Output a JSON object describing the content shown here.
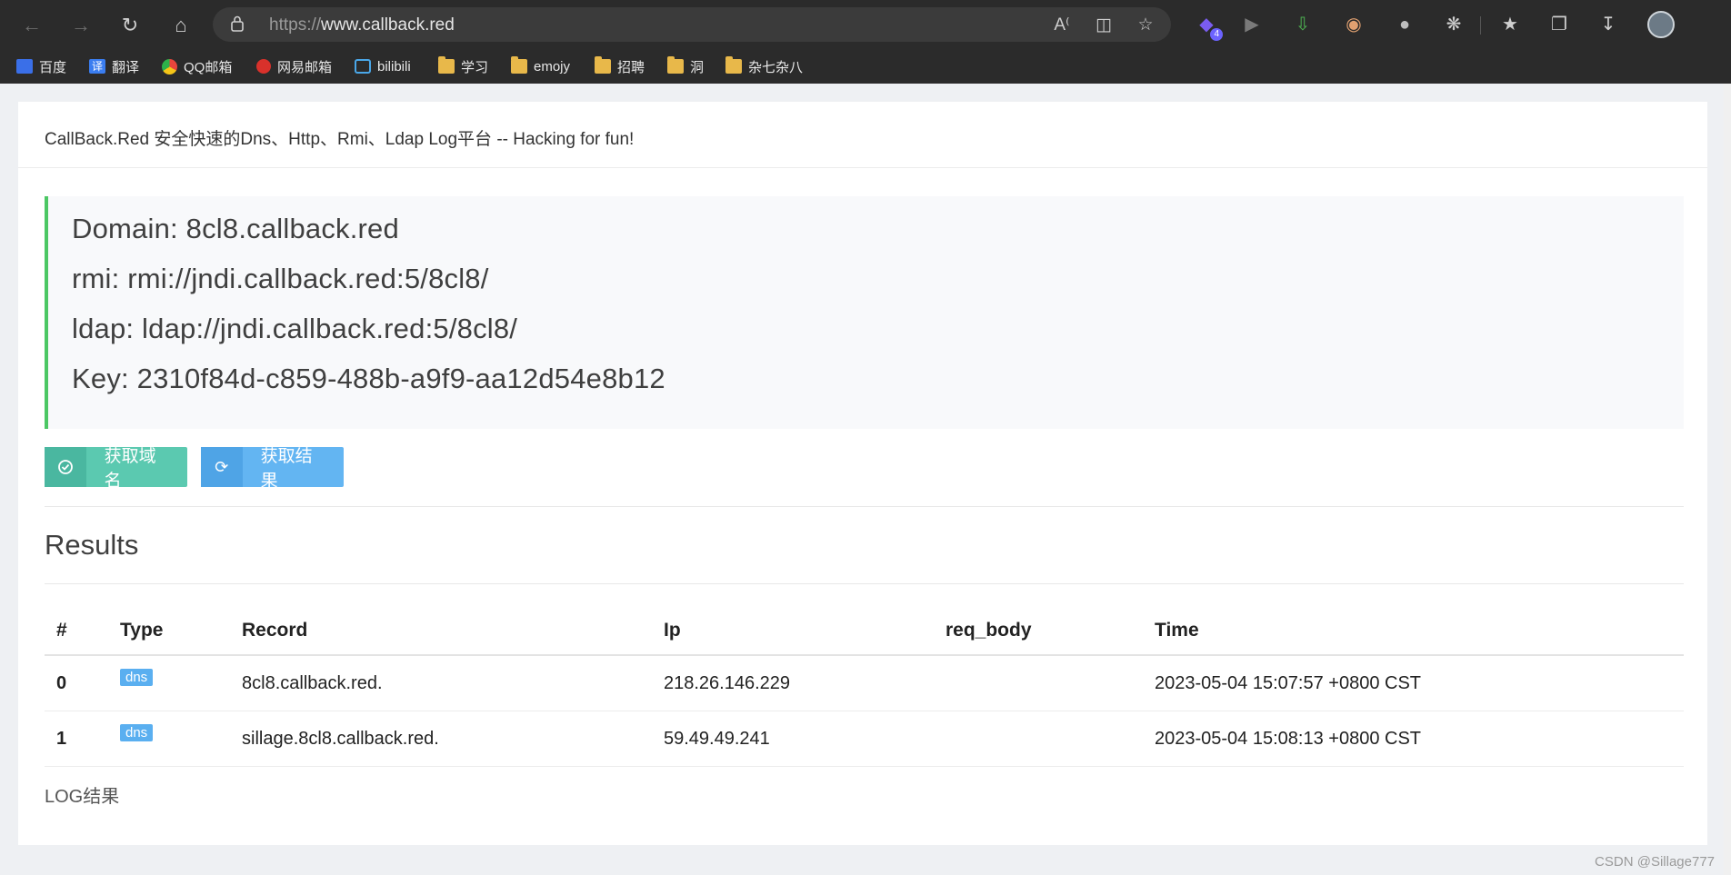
{
  "browser": {
    "url_scheme": "https://",
    "url_host": "www.callback.red",
    "extension_badge": "4",
    "bookmarks": [
      {
        "label": "百度",
        "icon": "baidu-icon",
        "color": "#3a6fe8"
      },
      {
        "label": "翻译",
        "icon": "translate-icon",
        "color": "#3a7df0",
        "glyph": "译"
      },
      {
        "label": "QQ邮箱",
        "icon": "chrome-icon",
        "color": "#2db24a"
      },
      {
        "label": "网易邮箱",
        "icon": "netease-icon",
        "color": "#d9312b"
      },
      {
        "label": "bilibili",
        "icon": "bilibili-icon",
        "color": "#4aa7e8"
      },
      {
        "label": "学习",
        "icon": "folder-icon"
      },
      {
        "label": "emojy",
        "icon": "folder-icon"
      },
      {
        "label": "招聘",
        "icon": "folder-icon"
      },
      {
        "label": "洞",
        "icon": "folder-icon"
      },
      {
        "label": "杂七杂八",
        "icon": "folder-icon"
      }
    ]
  },
  "page": {
    "title": "CallBack.Red 安全快速的Dns、Http、Rmi、Ldap Log平台 -- Hacking for fun!",
    "info": {
      "domain": "Domain: 8cl8.callback.red",
      "rmi": "rmi: rmi://jndi.callback.red:5/8cl8/",
      "ldap": "ldap: ldap://jndi.callback.red:5/8cl8/",
      "key": "Key: 2310f84d-c859-488b-a9f9-aa12d54e8b12"
    },
    "buttons": {
      "get_domain": "获取域名",
      "get_results": "获取结果"
    },
    "results_title": "Results",
    "table": {
      "headers": [
        "#",
        "Type",
        "Record",
        "Ip",
        "req_body",
        "Time"
      ],
      "rows": [
        {
          "idx": "0",
          "type": "dns",
          "record": "8cl8.callback.red.",
          "ip": "218.26.146.229",
          "req_body": "",
          "time": "2023-05-04 15:07:57 +0800 CST"
        },
        {
          "idx": "1",
          "type": "dns",
          "record": "sillage.8cl8.callback.red.",
          "ip": "59.49.49.241",
          "req_body": "",
          "time": "2023-05-04 15:08:13 +0800 CST"
        }
      ]
    },
    "footer_label": "LOG结果",
    "watermark": "CSDN @Sillage777"
  },
  "colors": {
    "accent_green": "#4cc764",
    "button_green": "#5bc9b0",
    "button_blue": "#63b5f2",
    "badge_blue": "#5aaff0"
  }
}
